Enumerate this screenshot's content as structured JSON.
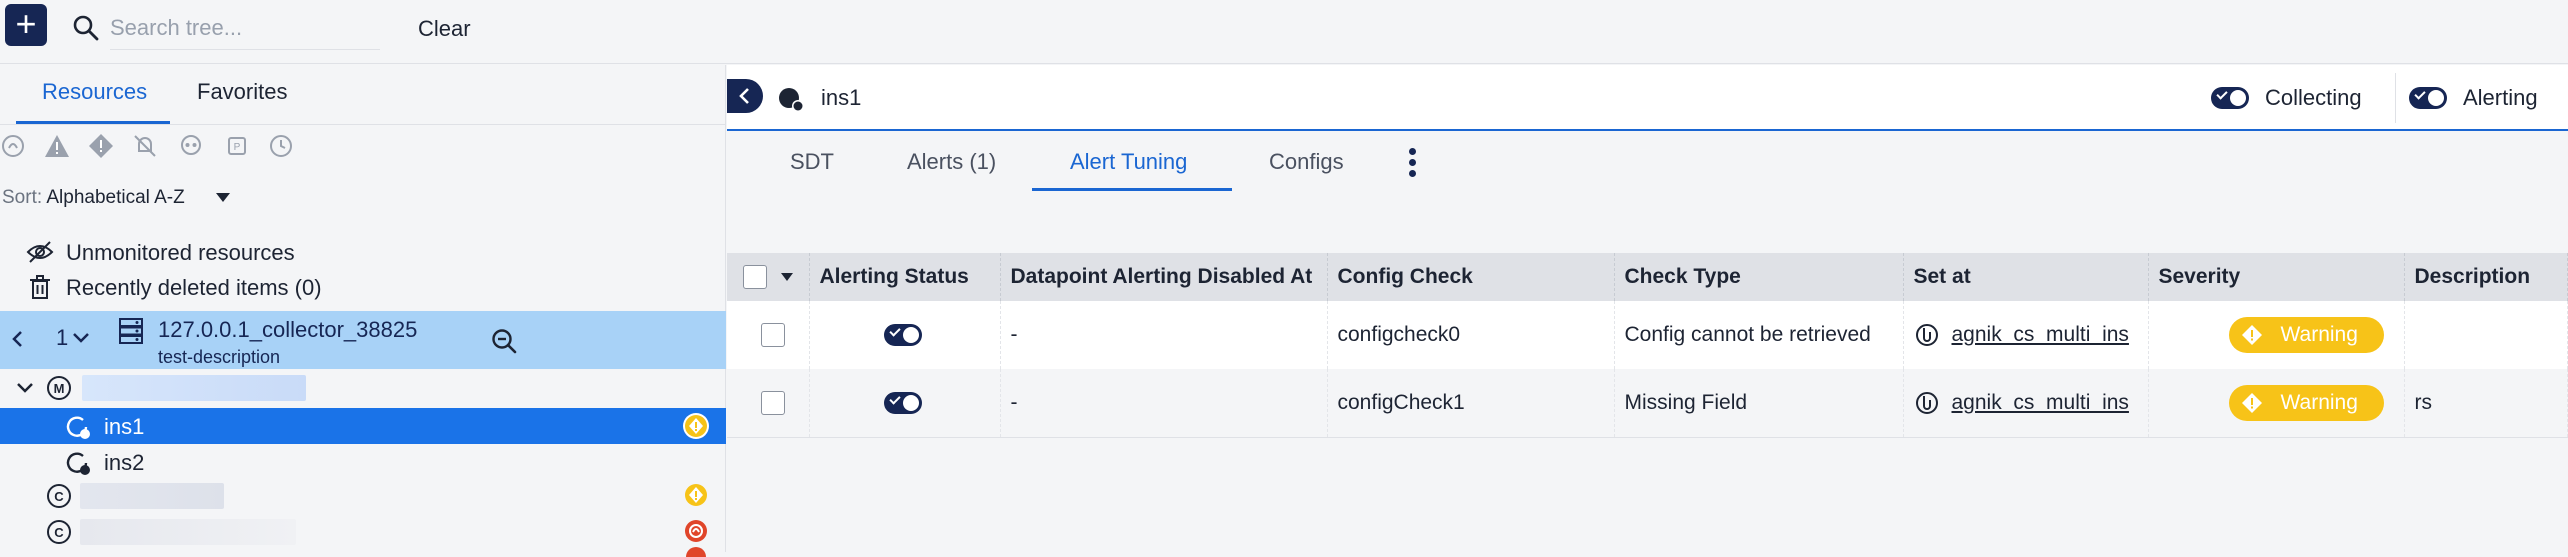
{
  "topbar": {
    "search_placeholder": "Search tree...",
    "clear_label": "Clear"
  },
  "left": {
    "tabs": [
      {
        "label": "Resources"
      },
      {
        "label": "Favorites"
      }
    ],
    "sort": {
      "label": "Sort:",
      "value": "Alphabetical A-Z"
    },
    "links": [
      {
        "label": "Unmonitored resources"
      },
      {
        "label": "Recently deleted items (0)"
      }
    ],
    "collector": {
      "count": "1",
      "name": "127.0.0.1_collector_38825",
      "description": "test-description"
    },
    "nodes": [
      {
        "label": "ins1"
      },
      {
        "label": "ins2"
      }
    ]
  },
  "right": {
    "title": "ins1",
    "collecting_label": "Collecting",
    "alerting_label": "Alerting",
    "tabs": [
      {
        "label": "SDT"
      },
      {
        "label": "Alerts (1)"
      },
      {
        "label": "Alert Tuning"
      },
      {
        "label": "Configs"
      }
    ],
    "table": {
      "headers": [
        "Alerting Status",
        "Datapoint Alerting Disabled At",
        "Config Check",
        "Check Type",
        "Set at",
        "Severity",
        "Description"
      ],
      "rows": [
        {
          "disabled_at": "-",
          "config_check": "configcheck0",
          "check_type": "Config cannot be retrieved",
          "set_at": "agnik_cs_multi_ins",
          "severity": "Warning",
          "description": ""
        },
        {
          "disabled_at": "-",
          "config_check": "configCheck1",
          "check_type": "Missing Field",
          "set_at": "agnik_cs_multi_ins",
          "severity": "Warning",
          "description": "rs"
        }
      ]
    }
  },
  "colors": {
    "navy": "#162654",
    "accent": "#1a66d2",
    "selected_row": "#1a73e8",
    "collector_row": "#a8d2f7",
    "warning": "#f7c318",
    "critical": "#e0452a"
  }
}
